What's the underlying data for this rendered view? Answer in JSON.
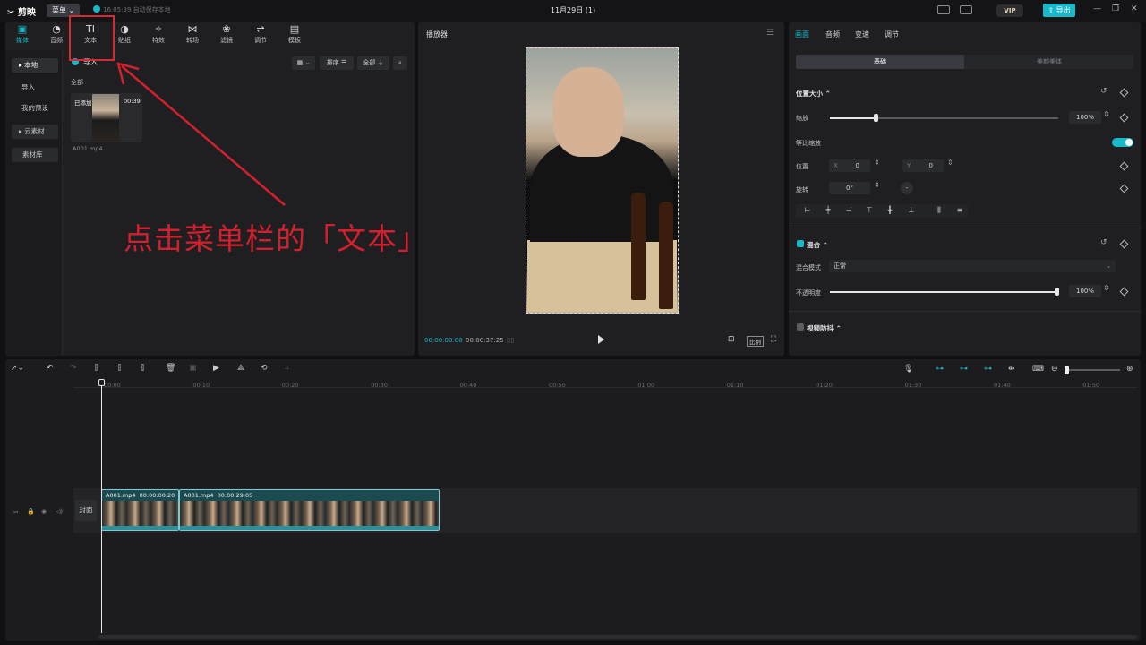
{
  "titlebar": {
    "app_name": "剪映",
    "menu_label": "菜单",
    "autosave_text": "16:05:39 自动保存本地",
    "doc_title": "11月29日 (1)",
    "vip_label": "VIP",
    "export_label": "导出"
  },
  "media_panel": {
    "top_tabs": [
      {
        "label": "媒体",
        "icon": "media-icon",
        "glyph": "▣"
      },
      {
        "label": "音频",
        "icon": "audio-icon",
        "glyph": "◔"
      },
      {
        "label": "文本",
        "icon": "text-icon",
        "glyph": "TI"
      },
      {
        "label": "贴纸",
        "icon": "sticker-icon",
        "glyph": "◑"
      },
      {
        "label": "特效",
        "icon": "effects-icon",
        "glyph": "✧"
      },
      {
        "label": "转场",
        "icon": "transition-icon",
        "glyph": "⋈"
      },
      {
        "label": "滤镜",
        "icon": "filter-icon",
        "glyph": "❀"
      },
      {
        "label": "调节",
        "icon": "adjust-icon",
        "glyph": "⇌"
      },
      {
        "label": "模板",
        "icon": "template-icon",
        "glyph": "▤"
      }
    ],
    "side_items": [
      "本地",
      "导入",
      "我的预设",
      "云素材",
      "素材库"
    ],
    "import_label": "导入",
    "sort_label": "排序",
    "filter_label": "全部",
    "section_label": "全部",
    "asset": {
      "badge": "已添加",
      "duration": "00:39",
      "filename": "A001.mp4"
    }
  },
  "player": {
    "title": "播放器",
    "current_time": "00:00:00:00",
    "total_time": "00:00:37:25",
    "ratio_label": "比例"
  },
  "properties": {
    "tabs": [
      "画面",
      "音频",
      "变速",
      "调节"
    ],
    "subtabs": [
      "基础",
      "美颜美体"
    ],
    "position_size_title": "位置大小",
    "scale_label": "缩放",
    "scale_value": "100%",
    "scale_level": 0.2,
    "proportional_label": "等比缩放",
    "position_label": "位置",
    "x_label": "X",
    "x_value": "0",
    "y_label": "Y",
    "y_value": "0",
    "rotation_label": "旋转",
    "rotation_value": "0°",
    "blend_title": "混合",
    "blend_mode_label": "混合模式",
    "blend_mode_value": "正常",
    "opacity_label": "不透明度",
    "opacity_value": "100%",
    "opacity_level": 1.0,
    "stabilize_title": "视频防抖",
    "accent_color": "#19b8c9"
  },
  "timeline": {
    "ruler": [
      "00:00",
      "00:10",
      "00:20",
      "00:30",
      "00:40",
      "00:50",
      "01:00",
      "01:10",
      "01:20",
      "01:30",
      "01:40",
      "01:50"
    ],
    "cover_label": "封面",
    "clips": [
      {
        "name": "A001.mp4",
        "duration": "00:00:00:20"
      },
      {
        "name": "A001.mp4",
        "duration": "00:00:29:05"
      }
    ]
  },
  "annotation": {
    "text": "点击菜单栏的「文本」",
    "color": "#d3202e"
  }
}
